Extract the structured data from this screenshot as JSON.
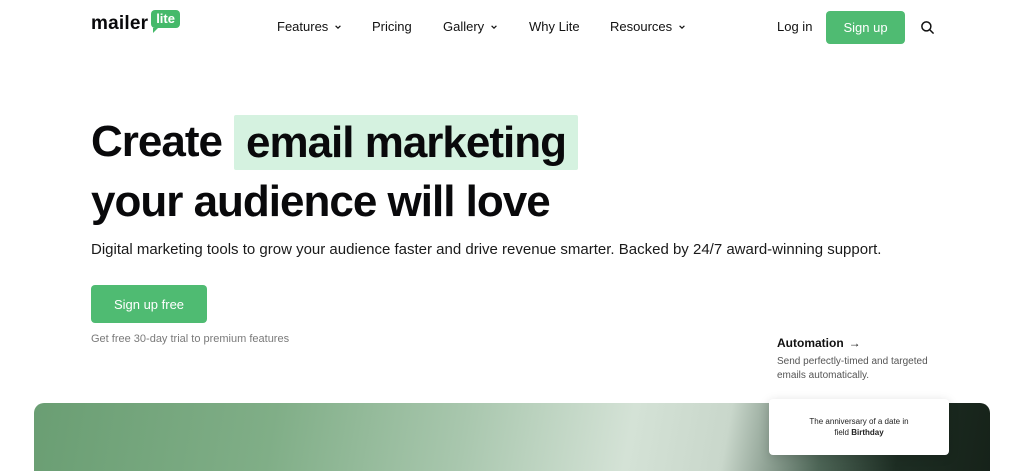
{
  "logo": {
    "word": "mailer",
    "badge": "lite"
  },
  "nav": {
    "items": [
      {
        "label": "Features",
        "has_dropdown": true
      },
      {
        "label": "Pricing",
        "has_dropdown": false
      },
      {
        "label": "Gallery",
        "has_dropdown": true
      },
      {
        "label": "Why Lite",
        "has_dropdown": false
      },
      {
        "label": "Resources",
        "has_dropdown": true
      }
    ],
    "login_label": "Log in",
    "signup_label": "Sign up",
    "search_icon": "search-icon"
  },
  "hero": {
    "headline_start": "Create",
    "headline_highlight": "email marketing",
    "headline_line2": "your audience will love",
    "subtitle": "Digital marketing tools to grow your audience faster and drive revenue smarter. Backed by 24/7 award-winning support.",
    "cta_label": "Sign up free",
    "trial_note": "Get free 30-day trial to premium features"
  },
  "feature_blurb": {
    "title": "Automation",
    "arrow": "→",
    "description": "Send perfectly-timed and targeted emails automatically."
  },
  "event_card": {
    "line1": "The anniversary of a date in",
    "prefix": "field",
    "field_name": "Birthday"
  },
  "colors": {
    "accent": "#4fbb72",
    "highlight": "#d5f2e0",
    "text": "#09090b"
  }
}
